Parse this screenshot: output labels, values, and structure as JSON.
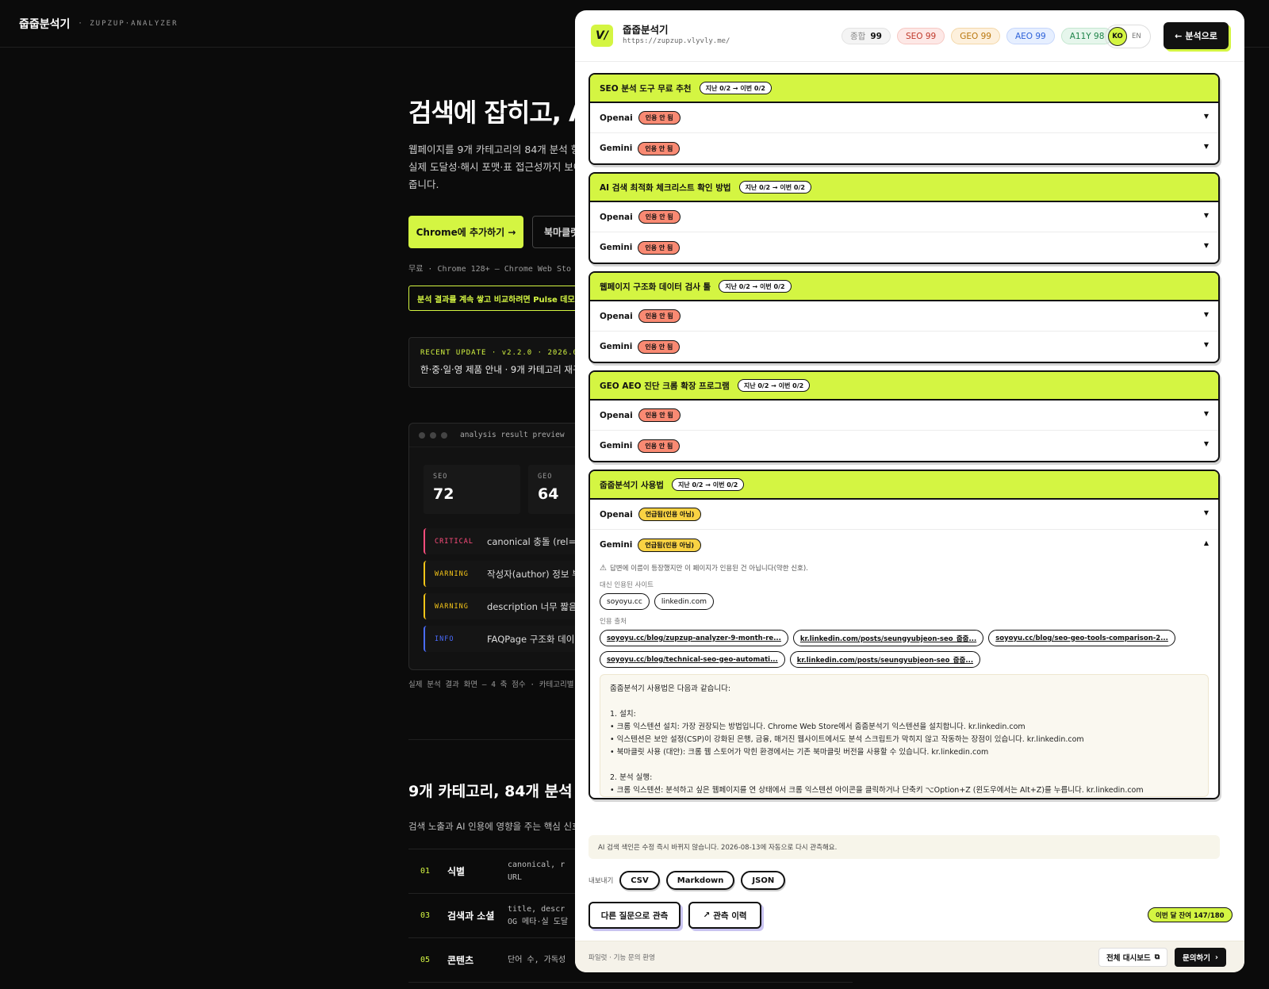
{
  "bg": {
    "brand": "줍줍분석기",
    "brand_sub": "· ZUPZUP·ANALYZER",
    "hero_title": "검색에 잡히고, A",
    "hero_desc": "웹페이지를 9개 카테고리의 84개 분석 항라 실제 도달성·해시 포맷·표 접근성까지 보여줍니다.",
    "chrome_btn": "Chrome에 추가하기 →",
    "bookmark_btn": "북마클릿",
    "meta": "무료 · Chrome 128+ — Chrome Web Sto",
    "pulse": "분석 결과를 계속 쌓고 비교하려면 Pulse 데모 !",
    "update_k": "RECENT UPDATE · v2.2.0 · 2026.07",
    "update_t": "한·중·일·영 제품 안내 · 9개 카테고리 재구성",
    "preview_label": "analysis result preview",
    "scores": [
      {
        "k": "SEO",
        "v": "72"
      },
      {
        "k": "GEO",
        "v": "64"
      }
    ],
    "issues": [
      {
        "level": "CRITICAL",
        "text": "canonical 충돌 (rel=ca",
        "color": "#ff4d7d"
      },
      {
        "level": "WARNING",
        "text": "작성자(author) 정보 부재",
        "color": "#f5c518"
      },
      {
        "level": "WARNING",
        "text": "description 너무 짧음 (",
        "color": "#f5c518"
      },
      {
        "level": "INFO",
        "text": "FAQPage 구조화 데이터",
        "color": "#4a6cff"
      }
    ],
    "preview_cap": "실제 분석 결과 화면 — 4 축 점수 · 카테고리별",
    "section_title": "9개 카테고리, 84개 분석 항",
    "section_desc": "검색 노출과 AI 인용에 영향을 주는 핵심 신호",
    "categories": [
      {
        "num": "01",
        "name": "식별",
        "desc1": "canonical, r",
        "desc2": "URL"
      },
      {
        "num": "03",
        "name": "검색과 소셜",
        "desc1": "title, descr",
        "desc2": "OG 메타·실 도달"
      },
      {
        "num": "05",
        "name": "콘텐츠",
        "desc1": "단어 수, 가독성",
        "desc2": ""
      }
    ]
  },
  "panel": {
    "logo": "V/",
    "name": "줍줍분석기",
    "url": "https://zupzup.vlyvly.me/",
    "scores": [
      {
        "label": "종합",
        "value": "99"
      },
      {
        "label": "SEO 99"
      },
      {
        "label": "GEO 99"
      },
      {
        "label": "AEO 99"
      },
      {
        "label": "A11Y 98"
      }
    ],
    "lang_ko": "KO",
    "lang_en": "EN",
    "back": "분석으로",
    "queries": [
      {
        "title": "SEO 분석 도구 무료 추천",
        "badge": "지난 0/2 → 이번 0/2",
        "rows": [
          {
            "engine": "Openai",
            "status": "인용 안 됨"
          },
          {
            "engine": "Gemini",
            "status": "인용 안 됨"
          }
        ]
      },
      {
        "title": "AI 검색 최적화 체크리스트 확인 방법",
        "badge": "지난 0/2 → 이번 0/2",
        "rows": [
          {
            "engine": "Openai",
            "status": "인용 안 됨"
          },
          {
            "engine": "Gemini",
            "status": "인용 안 됨"
          }
        ]
      },
      {
        "title": "웹페이지 구조화 데이터 검사 툴",
        "badge": "지난 0/2 → 이번 0/2",
        "rows": [
          {
            "engine": "Openai",
            "status": "인용 안 됨"
          },
          {
            "engine": "Gemini",
            "status": "인용 안 됨"
          }
        ]
      },
      {
        "title": "GEO AEO 진단 크롬 확장 프로그램",
        "badge": "지난 0/2 → 이번 0/2",
        "rows": [
          {
            "engine": "Openai",
            "status": "인용 안 됨"
          },
          {
            "engine": "Gemini",
            "status": "인용 안 됨"
          }
        ]
      },
      {
        "title": "줍줍분석기 사용법",
        "badge": "지난 0/2 → 이번 0/2",
        "rows": [
          {
            "engine": "Openai",
            "status": "언급됨(인용 아님)"
          },
          {
            "engine": "Gemini",
            "status": "언급됨(인용 아님)"
          }
        ]
      }
    ],
    "expanded": {
      "warning": "답변에 이름이 등장했지만 이 페이지가 인용된 건 아닙니다(약한 신호).",
      "alt_sites_label": "대신 인용된 사이트",
      "alt_sites": [
        "soyoyu.cc",
        "linkedin.com"
      ],
      "sources_label": "인용 출처",
      "sources": [
        "soyoyu.cc/blog/zupzup-analyzer-9-month-re...",
        "kr.linkedin.com/posts/seungyubjeon-seo_줍줍...",
        "soyoyu.cc/blog/seo-geo-tools-comparison-2...",
        "soyoyu.cc/blog/technical-seo-geo-automati...",
        "kr.linkedin.com/posts/seungyubjeon-seo_줍줍..."
      ],
      "answer": [
        "줍줍분석기 사용법은 다음과 같습니다:",
        "",
        "1. 설치:",
        "• 크롬 익스텐션 설치: 가장 권장되는 방법입니다. Chrome Web Store에서 줍줍분석기 익스텐션을 설치합니다. kr.linkedin.com",
        "• 익스텐션은 보안 설정(CSP)이 강화된 은행, 금융, 매거진 웹사이트에서도 분석 스크립트가 막히지 않고 작동하는 장점이 있습니다. kr.linkedin.com",
        "• 북마클릿 사용 (대안): 크롬 웹 스토어가 막힌 환경에서는 기존 북마클릿 버전을 사용할 수 있습니다. kr.linkedin.com",
        "",
        "2. 분석 실행:",
        "• 크롬 익스텐션: 분석하고 싶은 웹페이지를 연 상태에서 크롬 익스텐션 아이콘을 클릭하거나 단축키 ⌥Option+Z (윈도우에서는 Alt+Z)를 누릅니다. kr.linkedin.com"
      ]
    },
    "notice": "AI 검색 색인은 수정 즉시 바뀌지 않습니다. 2026-08-13에 자동으로 다시 관측해요.",
    "export_label": "내보내기",
    "export": [
      "CSV",
      "Markdown",
      "JSON"
    ],
    "action_other": "다른 질문으로 관측",
    "action_history": "관측 이력",
    "quota": "이번 달 잔여 147/180",
    "footer_text": "파일럿 · 기능 문의 환영",
    "dashboard": "전체 대시보드",
    "contact": "문의하기"
  }
}
